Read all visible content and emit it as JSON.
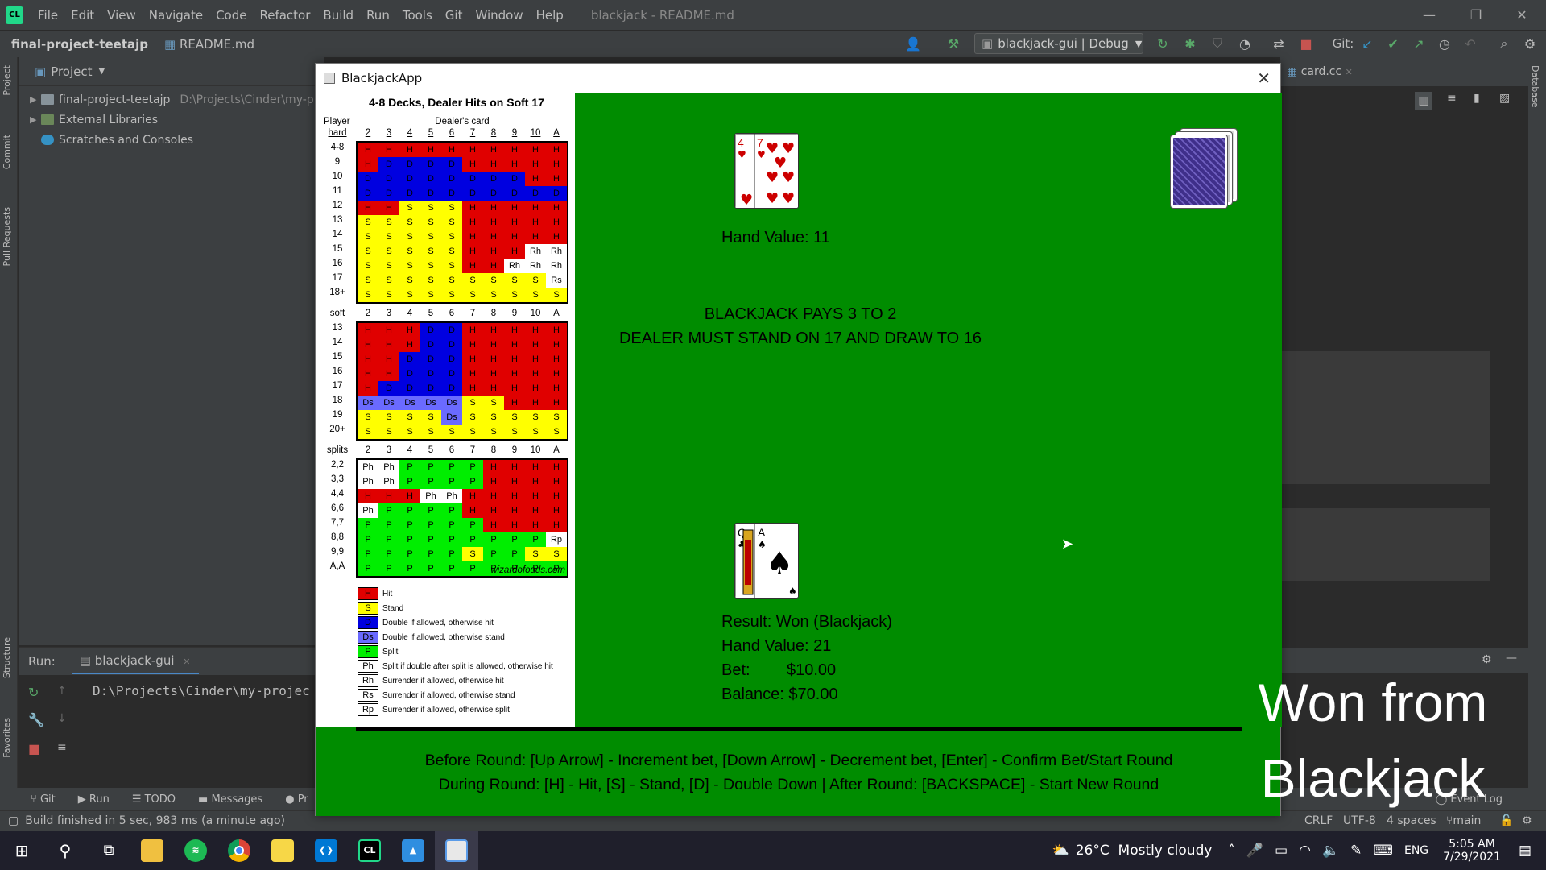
{
  "ide": {
    "menu": [
      "File",
      "Edit",
      "View",
      "Navigate",
      "Code",
      "Refactor",
      "Build",
      "Run",
      "Tools",
      "Git",
      "Window",
      "Help"
    ],
    "window_title": "blackjack - README.md",
    "project_name": "final-project-teetajp",
    "open_file": "README.md",
    "run_config": "blackjack-gui | Debug",
    "git_label": "Git:",
    "project_panel_title": "Project",
    "tree": [
      {
        "label": "final-project-teetajp",
        "path": "D:\\Projects\\Cinder\\my-p"
      },
      {
        "label": "External Libraries",
        "path": ""
      },
      {
        "label": "Scratches and Consoles",
        "path": ""
      }
    ],
    "side_tabs": [
      "Project",
      "Commit",
      "Pull Requests",
      "Structure",
      "Favorites"
    ],
    "right_tab": "Database",
    "editor_tab": "card.cc",
    "run_label": "Run:",
    "run_tab": "blackjack-gui",
    "run_command": "D:\\Projects\\Cinder\\my-projec",
    "bottom_tabs": [
      "Git",
      "Run",
      "TODO",
      "Messages",
      "Pr"
    ],
    "event_log": "Event Log",
    "status": "Build finished in 5 sec, 983 ms (a minute ago)",
    "status_right": [
      "CRLF",
      "UTF-8",
      "4 spaces",
      "main"
    ]
  },
  "app": {
    "title": "BlackjackApp",
    "chart": {
      "title": "4-8 Decks, Dealer Hits on Soft 17",
      "player_label": "Player",
      "dealer_label": "Dealer's card",
      "dealer_cards": [
        "2",
        "3",
        "4",
        "5",
        "6",
        "7",
        "8",
        "9",
        "10",
        "A"
      ],
      "sections": [
        {
          "name": "hard",
          "rows": [
            {
              "label": "4-8",
              "cells": [
                "H",
                "H",
                "H",
                "H",
                "H",
                "H",
                "H",
                "H",
                "H",
                "H"
              ]
            },
            {
              "label": "9",
              "cells": [
                "H",
                "D",
                "D",
                "D",
                "D",
                "H",
                "H",
                "H",
                "H",
                "H"
              ]
            },
            {
              "label": "10",
              "cells": [
                "D",
                "D",
                "D",
                "D",
                "D",
                "D",
                "D",
                "D",
                "H",
                "H"
              ]
            },
            {
              "label": "11",
              "cells": [
                "D",
                "D",
                "D",
                "D",
                "D",
                "D",
                "D",
                "D",
                "D",
                "D"
              ]
            },
            {
              "label": "12",
              "cells": [
                "H",
                "H",
                "S",
                "S",
                "S",
                "H",
                "H",
                "H",
                "H",
                "H"
              ]
            },
            {
              "label": "13",
              "cells": [
                "S",
                "S",
                "S",
                "S",
                "S",
                "H",
                "H",
                "H",
                "H",
                "H"
              ]
            },
            {
              "label": "14",
              "cells": [
                "S",
                "S",
                "S",
                "S",
                "S",
                "H",
                "H",
                "H",
                "H",
                "H"
              ]
            },
            {
              "label": "15",
              "cells": [
                "S",
                "S",
                "S",
                "S",
                "S",
                "H",
                "H",
                "H",
                "Rh",
                "Rh"
              ]
            },
            {
              "label": "16",
              "cells": [
                "S",
                "S",
                "S",
                "S",
                "S",
                "H",
                "H",
                "Rh",
                "Rh",
                "Rh"
              ]
            },
            {
              "label": "17",
              "cells": [
                "S",
                "S",
                "S",
                "S",
                "S",
                "S",
                "S",
                "S",
                "S",
                "Rs"
              ]
            },
            {
              "label": "18+",
              "cells": [
                "S",
                "S",
                "S",
                "S",
                "S",
                "S",
                "S",
                "S",
                "S",
                "S"
              ]
            }
          ]
        },
        {
          "name": "soft",
          "rows": [
            {
              "label": "13",
              "cells": [
                "H",
                "H",
                "H",
                "D",
                "D",
                "H",
                "H",
                "H",
                "H",
                "H"
              ]
            },
            {
              "label": "14",
              "cells": [
                "H",
                "H",
                "H",
                "D",
                "D",
                "H",
                "H",
                "H",
                "H",
                "H"
              ]
            },
            {
              "label": "15",
              "cells": [
                "H",
                "H",
                "D",
                "D",
                "D",
                "H",
                "H",
                "H",
                "H",
                "H"
              ]
            },
            {
              "label": "16",
              "cells": [
                "H",
                "H",
                "D",
                "D",
                "D",
                "H",
                "H",
                "H",
                "H",
                "H"
              ]
            },
            {
              "label": "17",
              "cells": [
                "H",
                "D",
                "D",
                "D",
                "D",
                "H",
                "H",
                "H",
                "H",
                "H"
              ]
            },
            {
              "label": "18",
              "cells": [
                "Ds",
                "Ds",
                "Ds",
                "Ds",
                "Ds",
                "S",
                "S",
                "H",
                "H",
                "H"
              ]
            },
            {
              "label": "19",
              "cells": [
                "S",
                "S",
                "S",
                "S",
                "Ds",
                "S",
                "S",
                "S",
                "S",
                "S"
              ]
            },
            {
              "label": "20+",
              "cells": [
                "S",
                "S",
                "S",
                "S",
                "S",
                "S",
                "S",
                "S",
                "S",
                "S"
              ]
            }
          ]
        },
        {
          "name": "splits",
          "rows": [
            {
              "label": "2,2",
              "cells": [
                "Ph",
                "Ph",
                "P",
                "P",
                "P",
                "P",
                "H",
                "H",
                "H",
                "H"
              ]
            },
            {
              "label": "3,3",
              "cells": [
                "Ph",
                "Ph",
                "P",
                "P",
                "P",
                "P",
                "H",
                "H",
                "H",
                "H"
              ]
            },
            {
              "label": "4,4",
              "cells": [
                "H",
                "H",
                "H",
                "Ph",
                "Ph",
                "H",
                "H",
                "H",
                "H",
                "H"
              ]
            },
            {
              "label": "6,6",
              "cells": [
                "Ph",
                "P",
                "P",
                "P",
                "P",
                "H",
                "H",
                "H",
                "H",
                "H"
              ]
            },
            {
              "label": "7,7",
              "cells": [
                "P",
                "P",
                "P",
                "P",
                "P",
                "P",
                "H",
                "H",
                "H",
                "H"
              ]
            },
            {
              "label": "8,8",
              "cells": [
                "P",
                "P",
                "P",
                "P",
                "P",
                "P",
                "P",
                "P",
                "P",
                "Rp"
              ]
            },
            {
              "label": "9,9",
              "cells": [
                "P",
                "P",
                "P",
                "P",
                "P",
                "S",
                "P",
                "P",
                "S",
                "S"
              ]
            },
            {
              "label": "A,A",
              "cells": [
                "P",
                "P",
                "P",
                "P",
                "P",
                "P",
                "P",
                "P",
                "P",
                "P"
              ]
            }
          ]
        }
      ],
      "source": "wizardofodds.com",
      "colors": {
        "H": "#e00000",
        "S": "#ffff00",
        "D": "#0000e0",
        "Ds": "#6a6aff",
        "P": "#00ee00",
        "Ph": "#ffffff",
        "Rh": "#ffffff",
        "Rs": "#ffffff",
        "Rp": "#ffffff"
      },
      "legend": [
        {
          "code": "H",
          "text": "Hit"
        },
        {
          "code": "S",
          "text": "Stand"
        },
        {
          "code": "D",
          "text": "Double if allowed, otherwise hit"
        },
        {
          "code": "Ds",
          "text": "Double if allowed, otherwise stand"
        },
        {
          "code": "P",
          "text": "Split"
        },
        {
          "code": "Ph",
          "text": "Split if double after split is allowed, otherwise hit"
        },
        {
          "code": "Rh",
          "text": "Surrender if allowed, otherwise hit"
        },
        {
          "code": "Rs",
          "text": "Surrender if allowed, otherwise stand"
        },
        {
          "code": "Rp",
          "text": "Surrender if allowed, otherwise split"
        }
      ]
    },
    "dealer_hand_value": "Hand Value: 11",
    "rules_line1": "BLACKJACK PAYS 3 TO 2",
    "rules_line2": "DEALER MUST STAND ON 17 AND DRAW TO 16",
    "result": "Result: Won (Blackjack)",
    "player_hand_value": "Hand Value: 21",
    "bet_label": "Bet:",
    "bet_value": "$10.00",
    "balance": "Balance: $70.00",
    "instructions1": "Before Round: [Up Arrow] - Increment bet, [Down Arrow] - Decrement bet, [Enter] - Confirm Bet/Start Round",
    "instructions2": "During Round: [H] - Hit, [S] - Stand, [D] - Double Down | After Round: [BACKSPACE] - Start New Round",
    "dealer_cards_shown": [
      {
        "rank": "4",
        "suit": "♥"
      },
      {
        "rank": "7",
        "suit": "♥"
      }
    ],
    "player_cards_shown": [
      {
        "rank": "Q",
        "suit": "♣"
      },
      {
        "rank": "A",
        "suit": "♠"
      }
    ]
  },
  "overlay_caption": [
    "Won from",
    "Blackjack"
  ],
  "taskbar": {
    "weather": "26°C  Mostly cloudy",
    "lang": "ENG",
    "time": "5:05 AM",
    "date": "7/29/2021"
  }
}
